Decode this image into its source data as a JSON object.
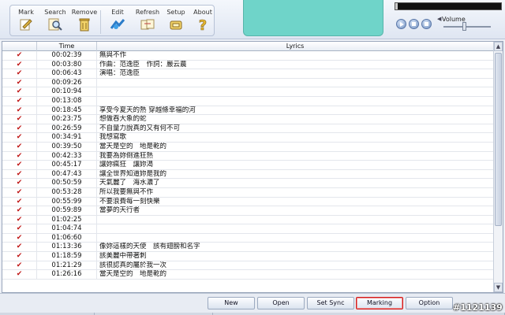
{
  "toolbar": {
    "buttons": [
      {
        "label": "Mark",
        "icon": "mark-pen-icon"
      },
      {
        "label": "Search",
        "icon": "search-magnifier-icon"
      },
      {
        "label": "Remove",
        "icon": "remove-trash-icon"
      },
      {
        "label": "Edit",
        "icon": "edit-icon"
      },
      {
        "label": "Refresh",
        "icon": "refresh-icon"
      },
      {
        "label": "Setup",
        "icon": "setup-icon"
      },
      {
        "label": "About",
        "icon": "help-question-icon"
      }
    ]
  },
  "player": {
    "volume_label": "Volume",
    "progress": 0.0
  },
  "table": {
    "columns": [
      "",
      "Time",
      "Lyrics"
    ],
    "rows": [
      {
        "time": "00:02:39",
        "lyrics": "無與不作"
      },
      {
        "time": "00:03:80",
        "lyrics": "作曲：范逸臣　作詞：嚴云農"
      },
      {
        "time": "00:06:43",
        "lyrics": "演唱：范逸臣"
      },
      {
        "time": "00:09:26",
        "lyrics": ""
      },
      {
        "time": "00:10:94",
        "lyrics": ""
      },
      {
        "time": "00:13:08",
        "lyrics": ""
      },
      {
        "time": "00:18:45",
        "lyrics": "享受今夏天的熱 穿越條幸福的河"
      },
      {
        "time": "00:23:75",
        "lyrics": "想做吞大象的蛇"
      },
      {
        "time": "00:26:59",
        "lyrics": "不自量力說真的又有何不可"
      },
      {
        "time": "00:34:91",
        "lyrics": "我想寫歌"
      },
      {
        "time": "00:39:50",
        "lyrics": "當天是空的　地是乾的"
      },
      {
        "time": "00:42:33",
        "lyrics": "我要為妳倒進狂熱"
      },
      {
        "time": "00:45:17",
        "lyrics": "讓妳瘋狂　讓妳渴"
      },
      {
        "time": "00:47:43",
        "lyrics": "讓全世界知道妳是我的"
      },
      {
        "time": "00:50:59",
        "lyrics": "天氣麗了　海水濃了"
      },
      {
        "time": "00:53:28",
        "lyrics": "所以我要無與不作"
      },
      {
        "time": "00:55:99",
        "lyrics": "不要浪費每一刻快樂"
      },
      {
        "time": "00:59:89",
        "lyrics": "當夢的天行者"
      },
      {
        "time": "01:02:25",
        "lyrics": ""
      },
      {
        "time": "01:04:74",
        "lyrics": ""
      },
      {
        "time": "01:06:60",
        "lyrics": ""
      },
      {
        "time": "01:13:36",
        "lyrics": "像妳這樣的天使　該有翅膀和名字"
      },
      {
        "time": "01:18:59",
        "lyrics": "該美麗中帶著刺"
      },
      {
        "time": "01:21:29",
        "lyrics": "該很認真的屬於我一次"
      },
      {
        "time": "01:26:16",
        "lyrics": "當天是空的　地是乾的"
      }
    ]
  },
  "bottom": {
    "buttons": [
      {
        "label": "New"
      },
      {
        "label": "Open"
      },
      {
        "label": "Set Sync"
      },
      {
        "label": "Marking"
      },
      {
        "label": "Option"
      }
    ],
    "watermark": "#1121139"
  },
  "colors": {
    "mark": "#c01818",
    "screen": "#6fd4c9",
    "selected_border": "#d01c1c"
  }
}
